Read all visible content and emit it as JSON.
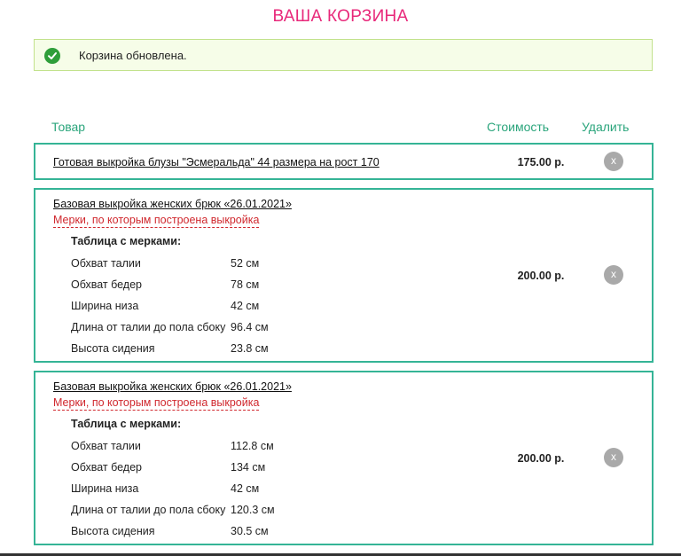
{
  "page": {
    "title": "ВАША КОРЗИНА"
  },
  "notice": {
    "message": "Корзина обновлена.",
    "icon": "check-circle-icon"
  },
  "columns": {
    "product": "Товар",
    "cost": "Стоимость",
    "remove": "Удалить"
  },
  "items": [
    {
      "name": "Готовая выкройка блузы \"Эсмеральда\" 44 размера на рост 170",
      "price": "175.00 р.",
      "remove": "x"
    },
    {
      "name": "Базовая выкройка женских брюк «26.01.2021»",
      "measure_link": "Мерки, по которым построена выкройка",
      "table_title": "Таблица с мерками:",
      "measures": [
        {
          "label": "Обхват талии",
          "value": "52 см"
        },
        {
          "label": "Обхват бедер",
          "value": "78 см"
        },
        {
          "label": "Ширина низа",
          "value": "42 см"
        },
        {
          "label": "Длина от талии до пола сбоку",
          "value": "96.4 см"
        },
        {
          "label": "Высота сидения",
          "value": "23.8 см"
        }
      ],
      "price": "200.00 р.",
      "remove": "x"
    },
    {
      "name": "Базовая выкройка женских брюк «26.01.2021»",
      "measure_link": "Мерки, по которым построена выкройка",
      "table_title": "Таблица с мерками:",
      "measures": [
        {
          "label": "Обхват талии",
          "value": "112.8 см"
        },
        {
          "label": "Обхват бедер",
          "value": "134 см"
        },
        {
          "label": "Ширина низа",
          "value": "42 см"
        },
        {
          "label": "Длина от талии до пола сбоку",
          "value": "120.3 см"
        },
        {
          "label": "Высота сидения",
          "value": "30.5 см"
        }
      ],
      "price": "200.00 р.",
      "remove": "x"
    }
  ],
  "colors": {
    "title": "#e8287a",
    "accent": "#35b496",
    "header": "#2ba57c",
    "link_red": "#d0282e",
    "notice_bg": "#f6fde8"
  }
}
